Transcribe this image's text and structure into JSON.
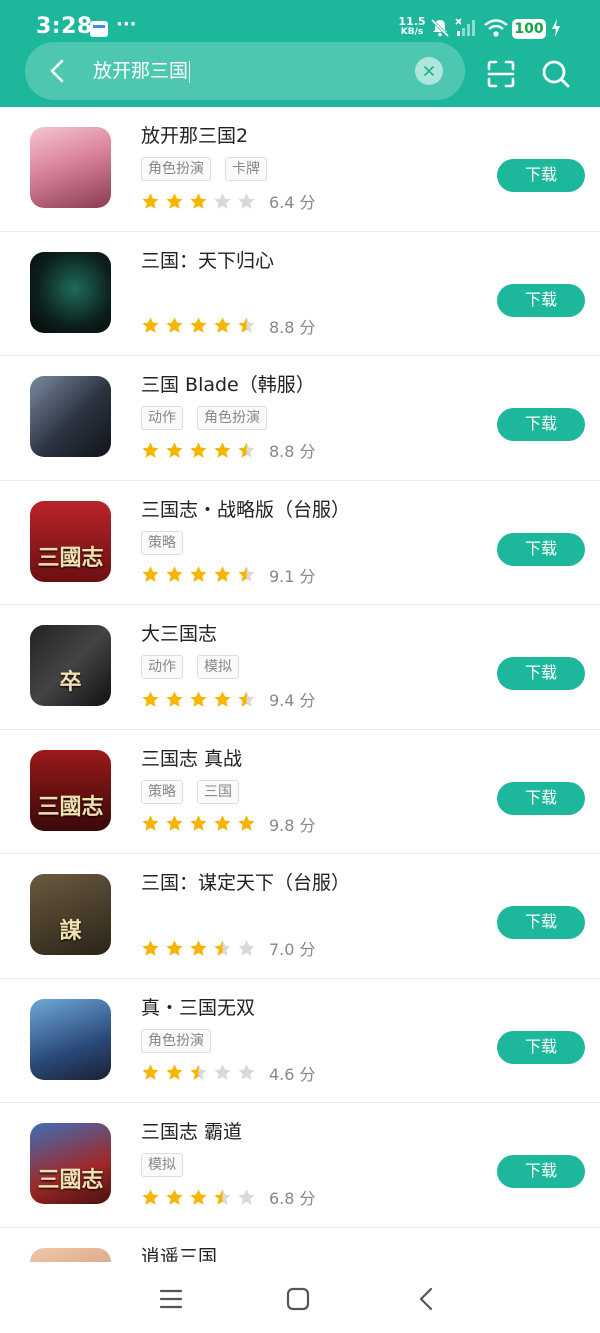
{
  "status_bar": {
    "time": "3:28",
    "more": "···",
    "net_speed_value": "11.5",
    "net_speed_unit": "KB/s",
    "battery": "100"
  },
  "search": {
    "query": "放开那三国"
  },
  "colors": {
    "accent": "#1db89c",
    "star_filled": "#f7b500",
    "star_empty": "#d9d9d9"
  },
  "apps": [
    {
      "name": "放开那三国2",
      "tags": [
        "角色扮演",
        "卡牌"
      ],
      "stars": 3,
      "score": "6.4 分",
      "button": "下载",
      "icon_desc": "anime-girl-icon"
    },
    {
      "name": "三国：天下归心",
      "tags": [],
      "stars": 4.5,
      "score": "8.8 分",
      "button": "下载",
      "icon_desc": "calligraphy-icon"
    },
    {
      "name": "三国 Blade（韩服）",
      "tags": [
        "动作",
        "角色扮演"
      ],
      "stars": 4.5,
      "score": "8.8 分",
      "button": "下载",
      "icon_desc": "warrior-icon"
    },
    {
      "name": "三国志・战略版（台服）",
      "tags": [
        "策略"
      ],
      "stars": 4.5,
      "score": "9.1 分",
      "button": "下载",
      "icon_desc": "sanguozhi-logo-icon",
      "icon_text": "三國志"
    },
    {
      "name": "大三国志",
      "tags": [
        "动作",
        "模拟"
      ],
      "stars": 4.5,
      "score": "9.4 分",
      "button": "下载",
      "icon_desc": "zu-character-icon",
      "icon_text": "卒"
    },
    {
      "name": "三国志 真战",
      "tags": [
        "策略",
        "三国"
      ],
      "stars": 5,
      "score": "9.8 分",
      "button": "下载",
      "icon_desc": "sanguozhi-zhenzhan-icon",
      "icon_text": "三國志"
    },
    {
      "name": "三国：谋定天下（台服）",
      "tags": [],
      "stars": 3.5,
      "score": "7.0 分",
      "button": "下载",
      "icon_desc": "mou-character-icon",
      "icon_text": "謀"
    },
    {
      "name": "真・三国无双",
      "tags": [
        "角色扮演"
      ],
      "stars": 2.5,
      "score": "4.6 分",
      "button": "下载",
      "icon_desc": "hero-portrait-icon"
    },
    {
      "name": "三国志 霸道",
      "tags": [
        "模拟"
      ],
      "stars": 3.5,
      "score": "6.8 分",
      "button": "下载",
      "icon_desc": "general-portrait-icon",
      "icon_text": "三國志"
    },
    {
      "name": "逍遥三国",
      "tags": [],
      "stars": 0,
      "score": "",
      "button": "",
      "icon_desc": "partial-icon"
    }
  ]
}
